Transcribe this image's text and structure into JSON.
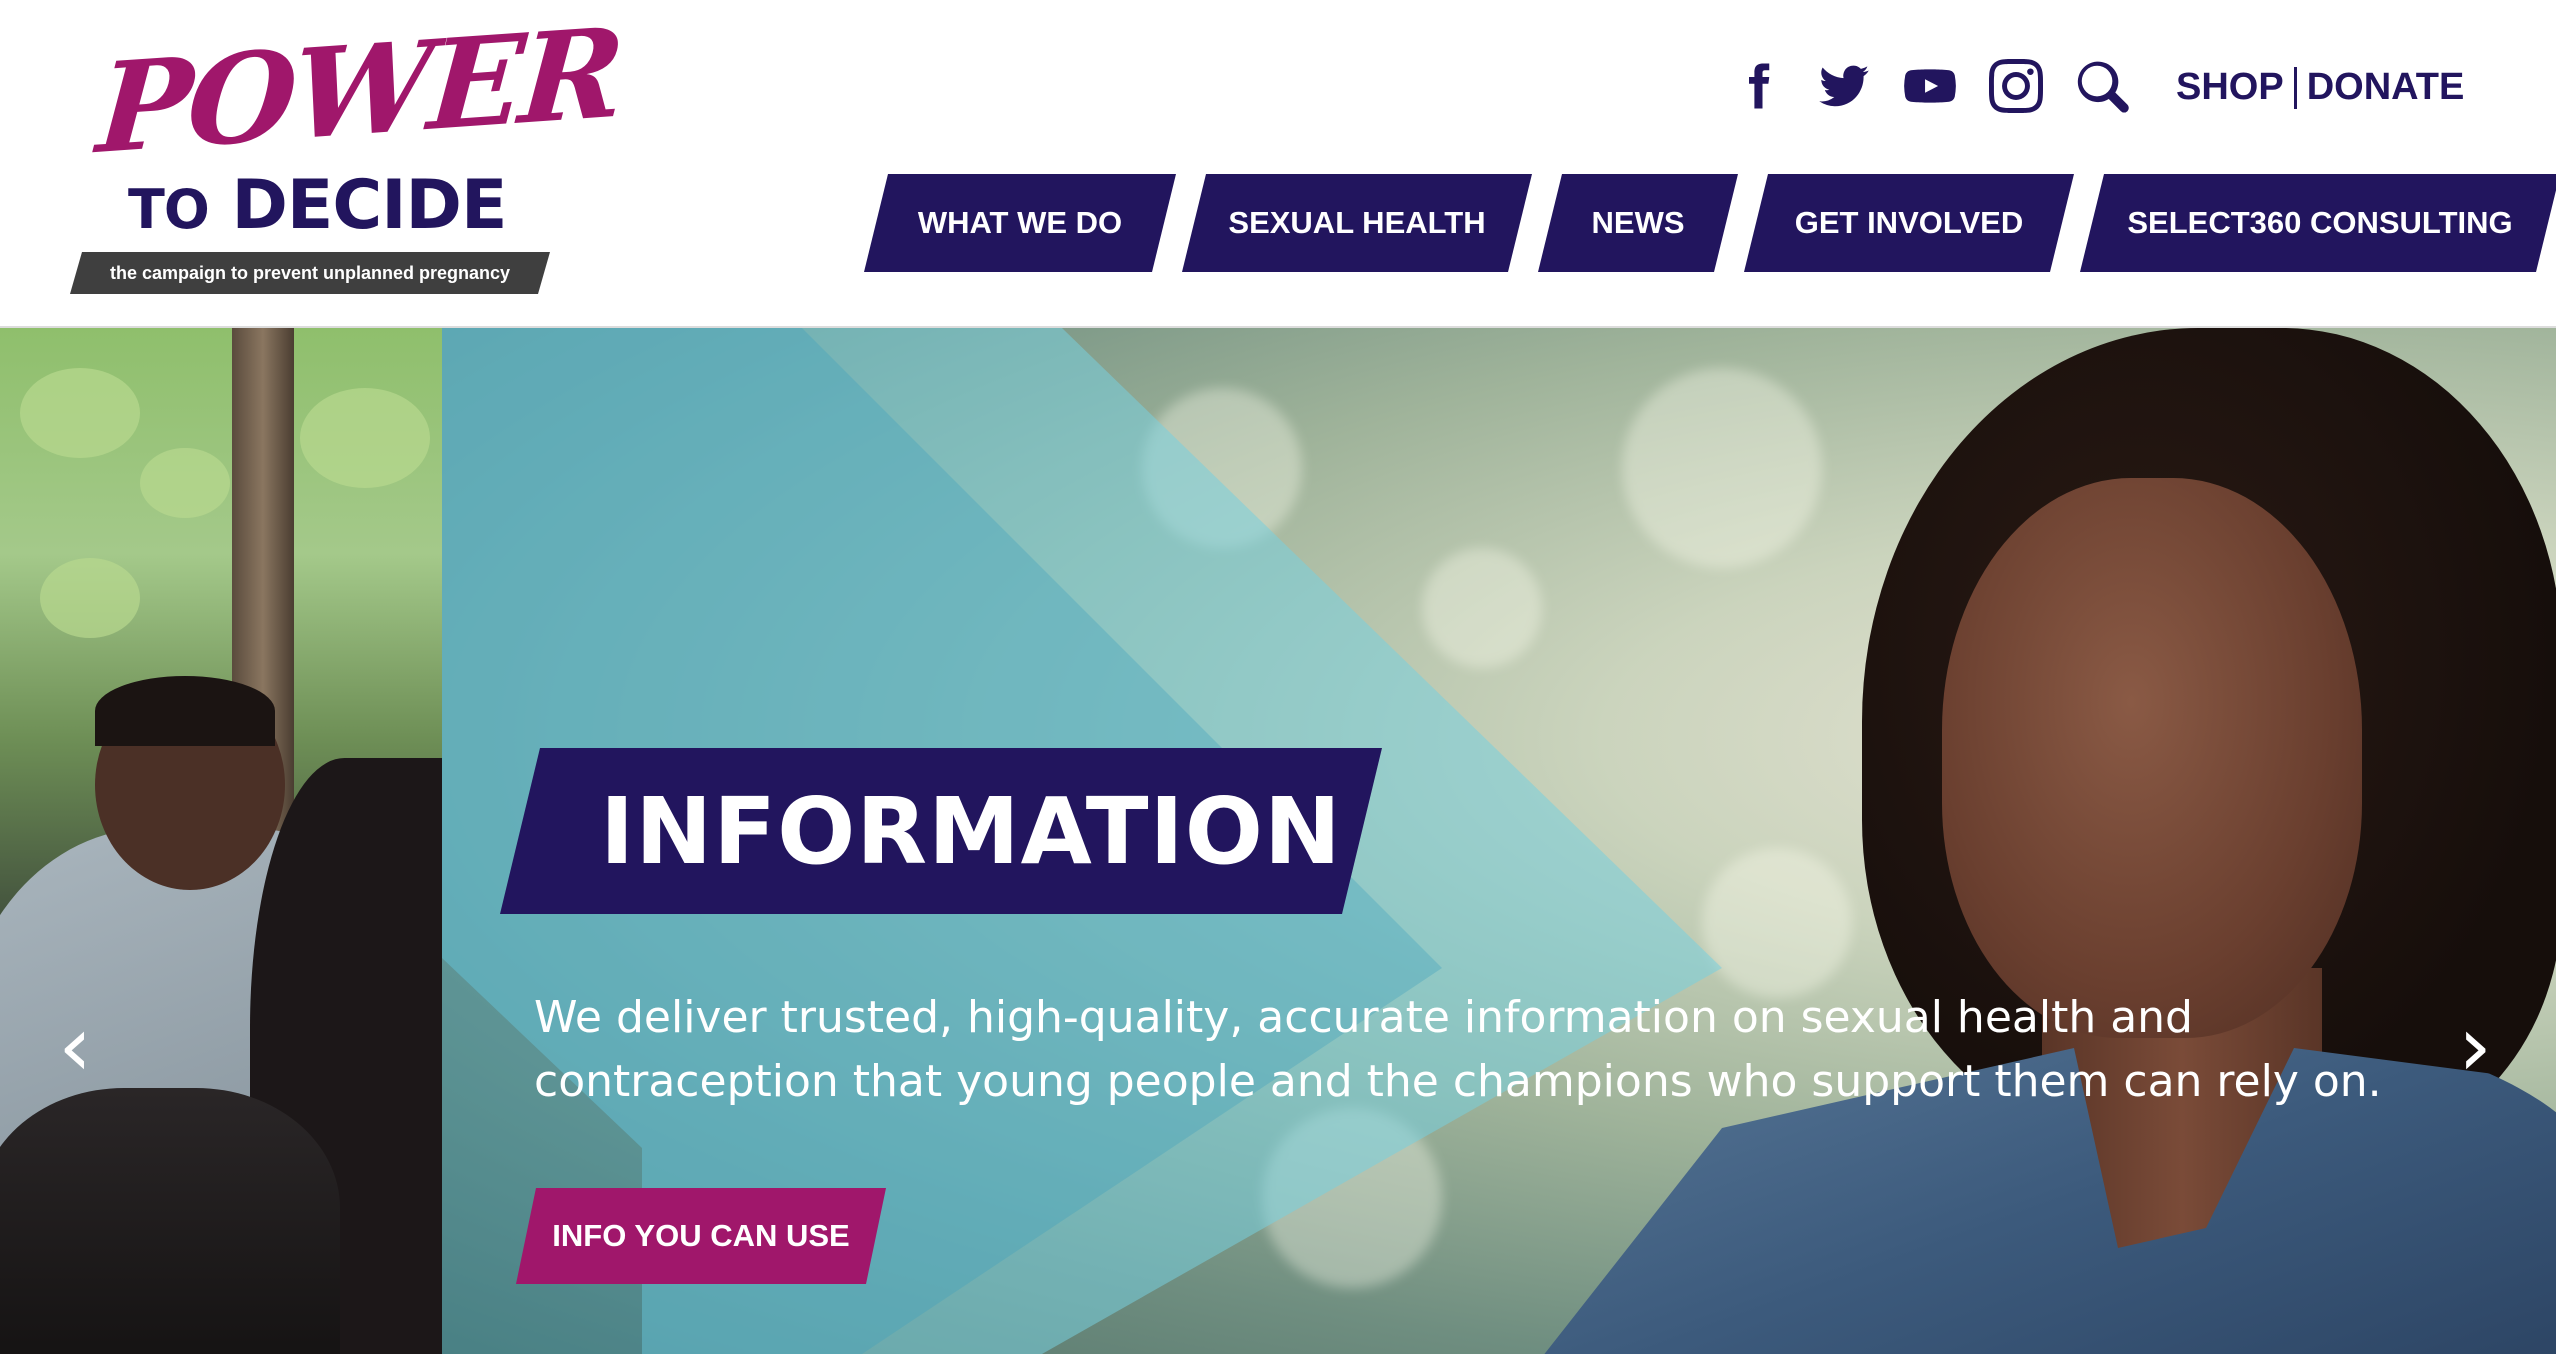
{
  "logo": {
    "power": "POWER",
    "to": "TO",
    "decide": "DECIDE",
    "tagline": "the campaign to prevent unplanned pregnancy"
  },
  "social": {
    "icons": [
      "facebook-icon",
      "twitter-icon",
      "youtube-icon",
      "instagram-icon",
      "search-icon"
    ]
  },
  "utility": {
    "shop": "SHOP",
    "donate": "DONATE"
  },
  "nav": {
    "items": [
      {
        "label": "WHAT WE DO"
      },
      {
        "label": "SEXUAL HEALTH"
      },
      {
        "label": "NEWS"
      },
      {
        "label": "GET INVOLVED"
      },
      {
        "label": "SELECT360 CONSULTING"
      }
    ]
  },
  "hero": {
    "title": "INFORMATION",
    "text": "We deliver trusted, high-quality, accurate information on sexual health and contraception that young people and the champions who support them can rely on.",
    "cta": "INFO YOU CAN USE",
    "prev": "‹",
    "next": "›"
  },
  "colors": {
    "navy": "#22155e",
    "magenta": "#a0176b",
    "tagline_bg": "#3f3f3f"
  }
}
